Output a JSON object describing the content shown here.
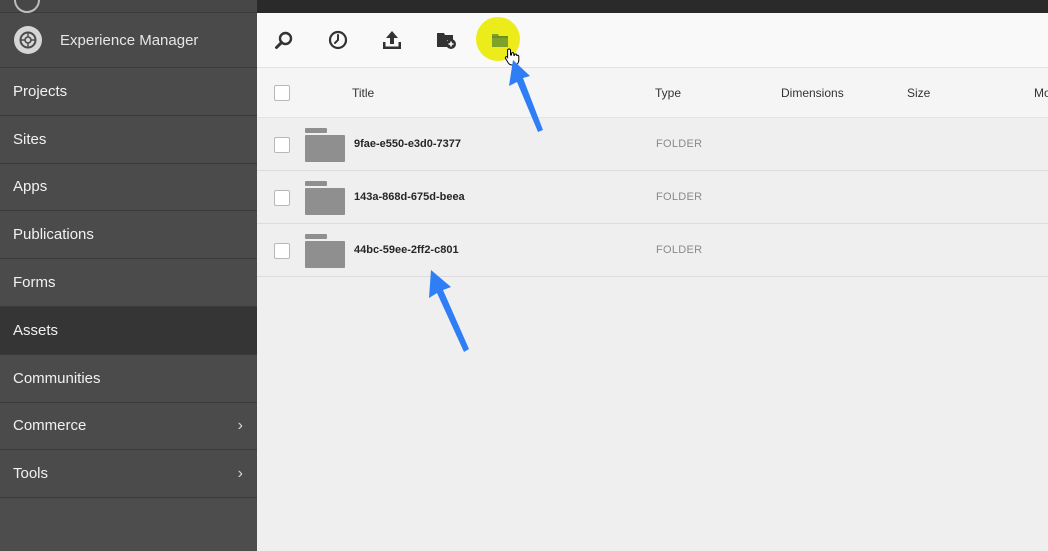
{
  "sidebar": {
    "brand_title": "Experience Manager",
    "items": [
      {
        "label": "Projects"
      },
      {
        "label": "Sites"
      },
      {
        "label": "Apps"
      },
      {
        "label": "Publications"
      },
      {
        "label": "Forms"
      },
      {
        "label": "Assets",
        "active": true
      },
      {
        "label": "Communities"
      },
      {
        "label": "Commerce",
        "has_submenu": true,
        "chevron": "›"
      },
      {
        "label": "Tools",
        "has_submenu": true,
        "chevron": "›"
      }
    ]
  },
  "toolbar": {
    "icons": [
      "search-icon",
      "history-icon",
      "upload-icon",
      "create-folder-icon",
      "new-folder-highlighted-icon"
    ],
    "highlight_color": "#ecec1a"
  },
  "table": {
    "columns": [
      "Title",
      "Type",
      "Dimensions",
      "Size",
      "Mo"
    ],
    "rows": [
      {
        "title": "9fae-e550-e3d0-7377",
        "type": "FOLDER"
      },
      {
        "title": "143a-868d-675d-beea",
        "type": "FOLDER"
      },
      {
        "title": "44bc-59ee-2ff2-c801",
        "type": "FOLDER"
      }
    ]
  },
  "annotations": {
    "arrow_color": "#2f7ef5"
  }
}
